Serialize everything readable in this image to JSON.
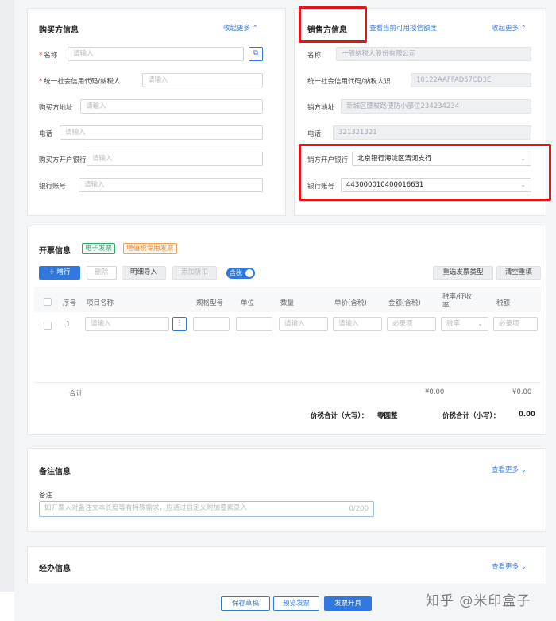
{
  "buyer": {
    "title": "购买方信息",
    "collapse": "收起更多 ⌃",
    "fields": [
      {
        "label": "名称",
        "required": true,
        "placeholder": "请输入"
      },
      {
        "label": "统一社会信用代码/纳税人",
        "required": true,
        "placeholder": "请输入"
      },
      {
        "label": "购买方地址",
        "required": false,
        "placeholder": "请输入"
      },
      {
        "label": "电话",
        "required": false,
        "placeholder": "请输入"
      },
      {
        "label": "购买方开户银行",
        "required": false,
        "placeholder": "请输入"
      },
      {
        "label": "银行账号",
        "required": false,
        "placeholder": "请输入"
      }
    ]
  },
  "seller": {
    "title": "销售方信息",
    "quota_link": "查看当前可用授信额度",
    "collapse": "收起更多 ⌃",
    "fields": [
      {
        "label": "名称",
        "value": "一般纳税人股份有限公司"
      },
      {
        "label": "统一社会信用代码/纳税人识",
        "value": "10122AAFFAD57CD3E"
      },
      {
        "label": "销方地址",
        "value": "新城区腰杖路便防小部位234234234"
      },
      {
        "label": "电话",
        "value": "321321321"
      },
      {
        "label": "销方开户银行",
        "value": "北京银行海淀区清河支行"
      },
      {
        "label": "银行账号",
        "value": "443000010400016631"
      }
    ]
  },
  "invoice": {
    "title": "开票信息",
    "tag_electronic": "电子发票",
    "tag_special": "增值税专用发票",
    "toolbar": {
      "add_row": "+ 增行",
      "delete": "删除",
      "import": "明细导入",
      "add_discount": "添加折扣",
      "tax_incl": "含税",
      "reselect_type": "重选发票类型",
      "clear_all": "清空重填"
    },
    "columns": [
      "序号",
      "项目名称",
      "规格型号",
      "单位",
      "数量",
      "单价(含税)",
      "金额(含税)",
      "税率/征收率",
      "税额"
    ],
    "row": {
      "index": "1",
      "name_placeholder": "请输入",
      "qty_placeholder": "请输入",
      "price_placeholder": "请输入",
      "amount_placeholder": "必录项",
      "tax_rate_placeholder": "税率",
      "tax_placeholder": "必录项"
    },
    "subtotal_label": "合计",
    "subtotal_amount": "¥0.00",
    "subtotal_tax": "¥0.00",
    "total_upper_label": "价税合计（大写）：",
    "total_upper_value": "零圆整",
    "total_lower_label": "价税合计（小写）：",
    "total_lower_value": "0.00"
  },
  "remarks": {
    "title": "备注信息",
    "more": "查看更多 ⌄",
    "field_label": "备注",
    "placeholder": "如开票人对备注文本长度等有特殊需求，应通过自定义附加要素录入",
    "counter": "0/200"
  },
  "handler": {
    "title": "经办信息",
    "more": "查看更多 ⌄"
  },
  "footer": {
    "save_draft": "保存草稿",
    "preview": "预览发票",
    "issue": "发票开具"
  },
  "watermark": "知乎 @米印盒子",
  "colors": {
    "primary": "#2f78e0",
    "annotation_red": "#e0141b"
  }
}
